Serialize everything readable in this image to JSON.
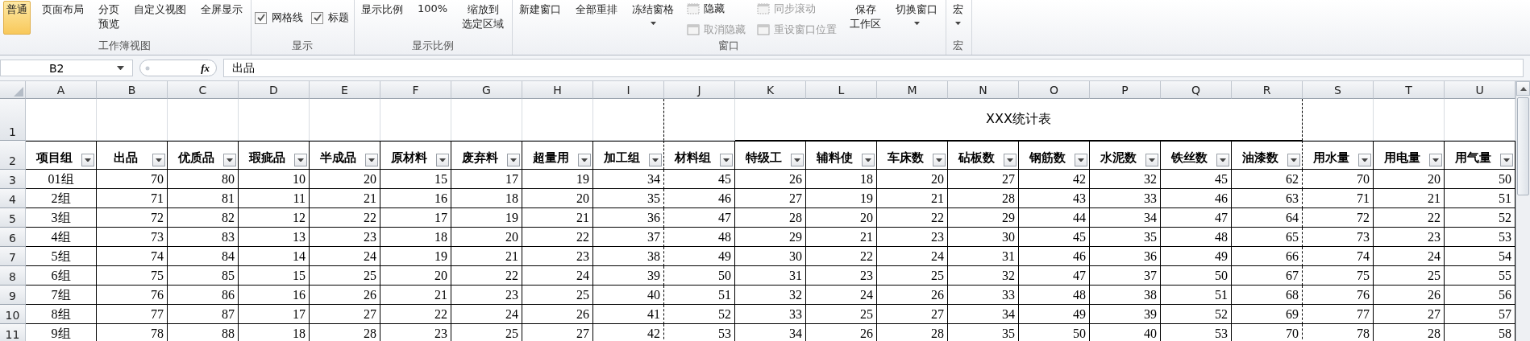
{
  "ribbon": {
    "groups": [
      {
        "label": "工作簿视图",
        "items": [
          {
            "kind": "view",
            "label": "普通",
            "selected": true
          },
          {
            "kind": "view",
            "label": "页面布局",
            "selected": false
          },
          {
            "kind": "view",
            "lines": [
              "分页",
              "预览"
            ],
            "selected": false
          },
          {
            "kind": "button",
            "label": "自定义视图"
          },
          {
            "kind": "button",
            "label": "全屏显示"
          }
        ]
      },
      {
        "label": "显示",
        "items": [
          {
            "kind": "checkbox",
            "label": "网格线",
            "checked": true
          },
          {
            "kind": "checkbox",
            "label": "标题",
            "checked": true
          }
        ]
      },
      {
        "label": "显示比例",
        "items": [
          {
            "kind": "button",
            "label": "显示比例"
          },
          {
            "kind": "button",
            "label": "100%"
          },
          {
            "kind": "button",
            "lines": [
              "缩放到",
              "选定区域"
            ]
          }
        ]
      },
      {
        "label": "窗口",
        "items": [
          {
            "kind": "button",
            "label": "新建窗口"
          },
          {
            "kind": "button",
            "label": "全部重排"
          },
          {
            "kind": "dropdown",
            "label": "冻结窗格"
          },
          {
            "kind": "stack",
            "items": [
              {
                "label": "隐藏",
                "disabled": false
              },
              {
                "label": "取消隐藏",
                "disabled": true
              }
            ]
          },
          {
            "kind": "stack",
            "items": [
              {
                "label": "同步滚动",
                "disabled": true
              },
              {
                "label": "重设窗口位置",
                "disabled": true
              }
            ]
          },
          {
            "kind": "button",
            "lines": [
              "保存",
              "工作区"
            ]
          },
          {
            "kind": "dropdown",
            "label": "切换窗口"
          }
        ]
      },
      {
        "label": "宏",
        "items": [
          {
            "kind": "dropdown",
            "label": "宏"
          }
        ]
      }
    ]
  },
  "formula_bar": {
    "name_box": "B2",
    "fx": "fx",
    "value": "出品"
  },
  "sheet": {
    "columns": [
      {
        "label": "A",
        "page_break": false
      },
      {
        "label": "B",
        "page_break": false
      },
      {
        "label": "C",
        "page_break": false
      },
      {
        "label": "D",
        "page_break": false
      },
      {
        "label": "E",
        "page_break": false
      },
      {
        "label": "F",
        "page_break": false
      },
      {
        "label": "G",
        "page_break": false
      },
      {
        "label": "H",
        "page_break": false
      },
      {
        "label": "I",
        "page_break": true
      },
      {
        "label": "J",
        "page_break": false
      },
      {
        "label": "K",
        "page_break": false
      },
      {
        "label": "L",
        "page_break": false
      },
      {
        "label": "M",
        "page_break": false
      },
      {
        "label": "N",
        "page_break": false
      },
      {
        "label": "O",
        "page_break": false
      },
      {
        "label": "P",
        "page_break": false
      },
      {
        "label": "Q",
        "page_break": false
      },
      {
        "label": "R",
        "page_break": true
      },
      {
        "label": "S",
        "page_break": false
      },
      {
        "label": "T",
        "page_break": false
      },
      {
        "label": "U",
        "page_break": false
      }
    ],
    "title_row": {
      "number": "1",
      "title": "XXX统计表"
    },
    "header_row": {
      "number": "2",
      "cells": [
        "项目组",
        "出品",
        "优质品",
        "瑕疵品",
        "半成品",
        "原材料",
        "废弃料",
        "超量用",
        "加工组",
        "材料组",
        "特级工",
        "辅料使",
        "车床数",
        "砧板数",
        "钢筋数",
        "水泥数",
        "铁丝数",
        "油漆数",
        "用水量",
        "用电量",
        "用气量"
      ]
    },
    "rows": [
      {
        "number": "3",
        "cells": [
          "01组",
          "70",
          "80",
          "10",
          "20",
          "15",
          "17",
          "19",
          "34",
          "45",
          "26",
          "18",
          "20",
          "27",
          "42",
          "32",
          "45",
          "62",
          "70",
          "20",
          "50"
        ]
      },
      {
        "number": "4",
        "cells": [
          "2组",
          "71",
          "81",
          "11",
          "21",
          "16",
          "18",
          "20",
          "35",
          "46",
          "27",
          "19",
          "21",
          "28",
          "43",
          "33",
          "46",
          "63",
          "71",
          "21",
          "51"
        ]
      },
      {
        "number": "5",
        "cells": [
          "3组",
          "72",
          "82",
          "12",
          "22",
          "17",
          "19",
          "21",
          "36",
          "47",
          "28",
          "20",
          "22",
          "29",
          "44",
          "34",
          "47",
          "64",
          "72",
          "22",
          "52"
        ]
      },
      {
        "number": "6",
        "cells": [
          "4组",
          "73",
          "83",
          "13",
          "23",
          "18",
          "20",
          "22",
          "37",
          "48",
          "29",
          "21",
          "23",
          "30",
          "45",
          "35",
          "48",
          "65",
          "73",
          "23",
          "53"
        ]
      },
      {
        "number": "7",
        "cells": [
          "5组",
          "74",
          "84",
          "14",
          "24",
          "19",
          "21",
          "23",
          "38",
          "49",
          "30",
          "22",
          "24",
          "31",
          "46",
          "36",
          "49",
          "66",
          "74",
          "24",
          "54"
        ]
      },
      {
        "number": "8",
        "cells": [
          "6组",
          "75",
          "85",
          "15",
          "25",
          "20",
          "22",
          "24",
          "39",
          "50",
          "31",
          "23",
          "25",
          "32",
          "47",
          "37",
          "50",
          "67",
          "75",
          "25",
          "55"
        ]
      },
      {
        "number": "9",
        "cells": [
          "7组",
          "76",
          "86",
          "16",
          "26",
          "21",
          "23",
          "25",
          "40",
          "51",
          "32",
          "24",
          "26",
          "33",
          "48",
          "38",
          "51",
          "68",
          "76",
          "26",
          "56"
        ]
      },
      {
        "number": "10",
        "cells": [
          "8组",
          "77",
          "87",
          "17",
          "27",
          "22",
          "24",
          "26",
          "41",
          "52",
          "33",
          "25",
          "27",
          "34",
          "49",
          "39",
          "52",
          "69",
          "77",
          "27",
          "57"
        ]
      },
      {
        "number": "11",
        "cells": [
          "9组",
          "78",
          "88",
          "18",
          "28",
          "23",
          "25",
          "27",
          "42",
          "53",
          "34",
          "26",
          "28",
          "35",
          "50",
          "40",
          "53",
          "70",
          "78",
          "28",
          "58"
        ]
      }
    ]
  }
}
